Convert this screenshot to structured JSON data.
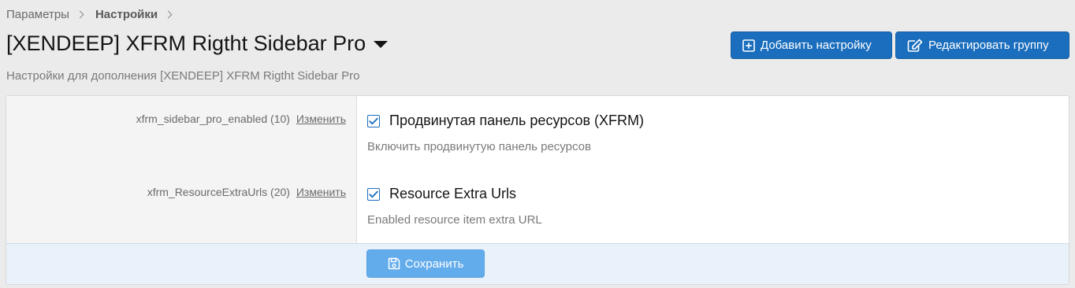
{
  "breadcrumb": {
    "items": [
      "Параметры",
      "Настройки"
    ]
  },
  "header": {
    "title": "[XENDEEP] XFRM Rigtht Sidebar Pro",
    "description": "Настройки для дополнения [XENDEEP] XFRM Rigtht Sidebar Pro",
    "add_button_label": "Добавить настройку",
    "edit_button_label": "Редактировать группу"
  },
  "options": [
    {
      "key_label": "xfrm_sidebar_pro_enabled (10)",
      "edit_link": "Изменить",
      "checked": true,
      "title": "Продвинутая панель ресурсов (XFRM)",
      "hint": "Включить продвинутую панель ресурсов"
    },
    {
      "key_label": "xfrm_ResourceExtraUrls (20)",
      "edit_link": "Изменить",
      "checked": true,
      "title": "Resource Extra Urls",
      "hint": "Enabled resource item extra URL"
    }
  ],
  "footer": {
    "save_label": "Сохранить"
  },
  "colors": {
    "primary": "#1a6ebd",
    "save_button": "#63acec",
    "footer_bg": "#e9f1fa",
    "page_bg": "#ebebeb"
  },
  "icons": {
    "add_button": "plus-square-icon",
    "edit_button": "edit-icon",
    "save_button": "save-icon",
    "title_menu": "caret-down-icon"
  }
}
